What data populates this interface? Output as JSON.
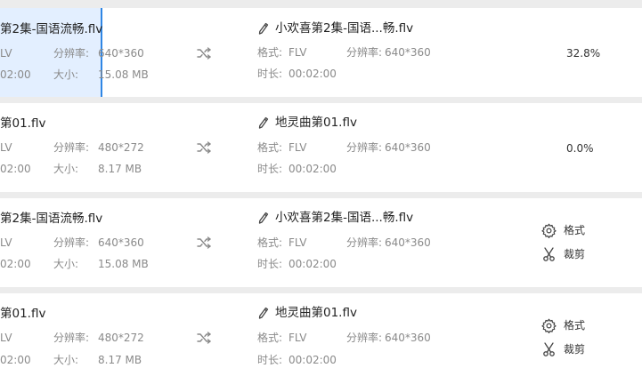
{
  "rows": [
    {
      "src_name": "第2集-国语流畅.flv",
      "src_format": "LV",
      "src_res_label": "分辨率:",
      "src_res": "640*360",
      "src_dur": "02:00",
      "src_size_label": "大小:",
      "src_size": "15.08 MB",
      "out_name": "小欢喜第2集-国语...畅.flv",
      "out_format_label": "格式:",
      "out_format": "FLV",
      "out_res_label": "分辨率:",
      "out_res": "640*360",
      "out_dur_label": "时长:",
      "out_dur": "00:02:00",
      "progress": "32.8%"
    },
    {
      "src_name": "第01.flv",
      "src_format": "LV",
      "src_res_label": "分辨率:",
      "src_res": "480*272",
      "src_dur": "02:00",
      "src_size_label": "大小:",
      "src_size": "8.17 MB",
      "out_name": "地灵曲第01.flv",
      "out_format_label": "格式:",
      "out_format": "FLV",
      "out_res_label": "分辨率:",
      "out_res": "640*360",
      "out_dur_label": "时长:",
      "out_dur": "00:02:00",
      "progress": "0.0%"
    },
    {
      "src_name": "第2集-国语流畅.flv",
      "src_format": "LV",
      "src_res_label": "分辨率:",
      "src_res": "640*360",
      "src_dur": "02:00",
      "src_size_label": "大小:",
      "src_size": "15.08 MB",
      "out_name": "小欢喜第2集-国语...畅.flv",
      "out_format_label": "格式:",
      "out_format": "FLV",
      "out_res_label": "分辨率:",
      "out_res": "640*360",
      "out_dur_label": "时长:",
      "out_dur": "00:02:00",
      "action_format": "格式",
      "action_cut": "裁剪"
    },
    {
      "src_name": "第01.flv",
      "src_format": "LV",
      "src_res_label": "分辨率:",
      "src_res": "480*272",
      "src_dur": "02:00",
      "src_size_label": "大小:",
      "src_size": "8.17 MB",
      "out_name": "地灵曲第01.flv",
      "out_format_label": "格式:",
      "out_format": "FLV",
      "out_res_label": "分辨率:",
      "out_res": "640*360",
      "out_dur_label": "时长:",
      "out_dur": "00:02:00",
      "action_format": "格式",
      "action_cut": "裁剪"
    }
  ],
  "icons": {
    "convert": "shuffle-icon",
    "rename": "pencil-icon",
    "format": "gear-icon",
    "cut": "scissors-icon"
  },
  "colors": {
    "selection": "#e3efff",
    "selection_bar": "#2f86e4",
    "label": "#8a8a8a",
    "text": "#222222"
  }
}
